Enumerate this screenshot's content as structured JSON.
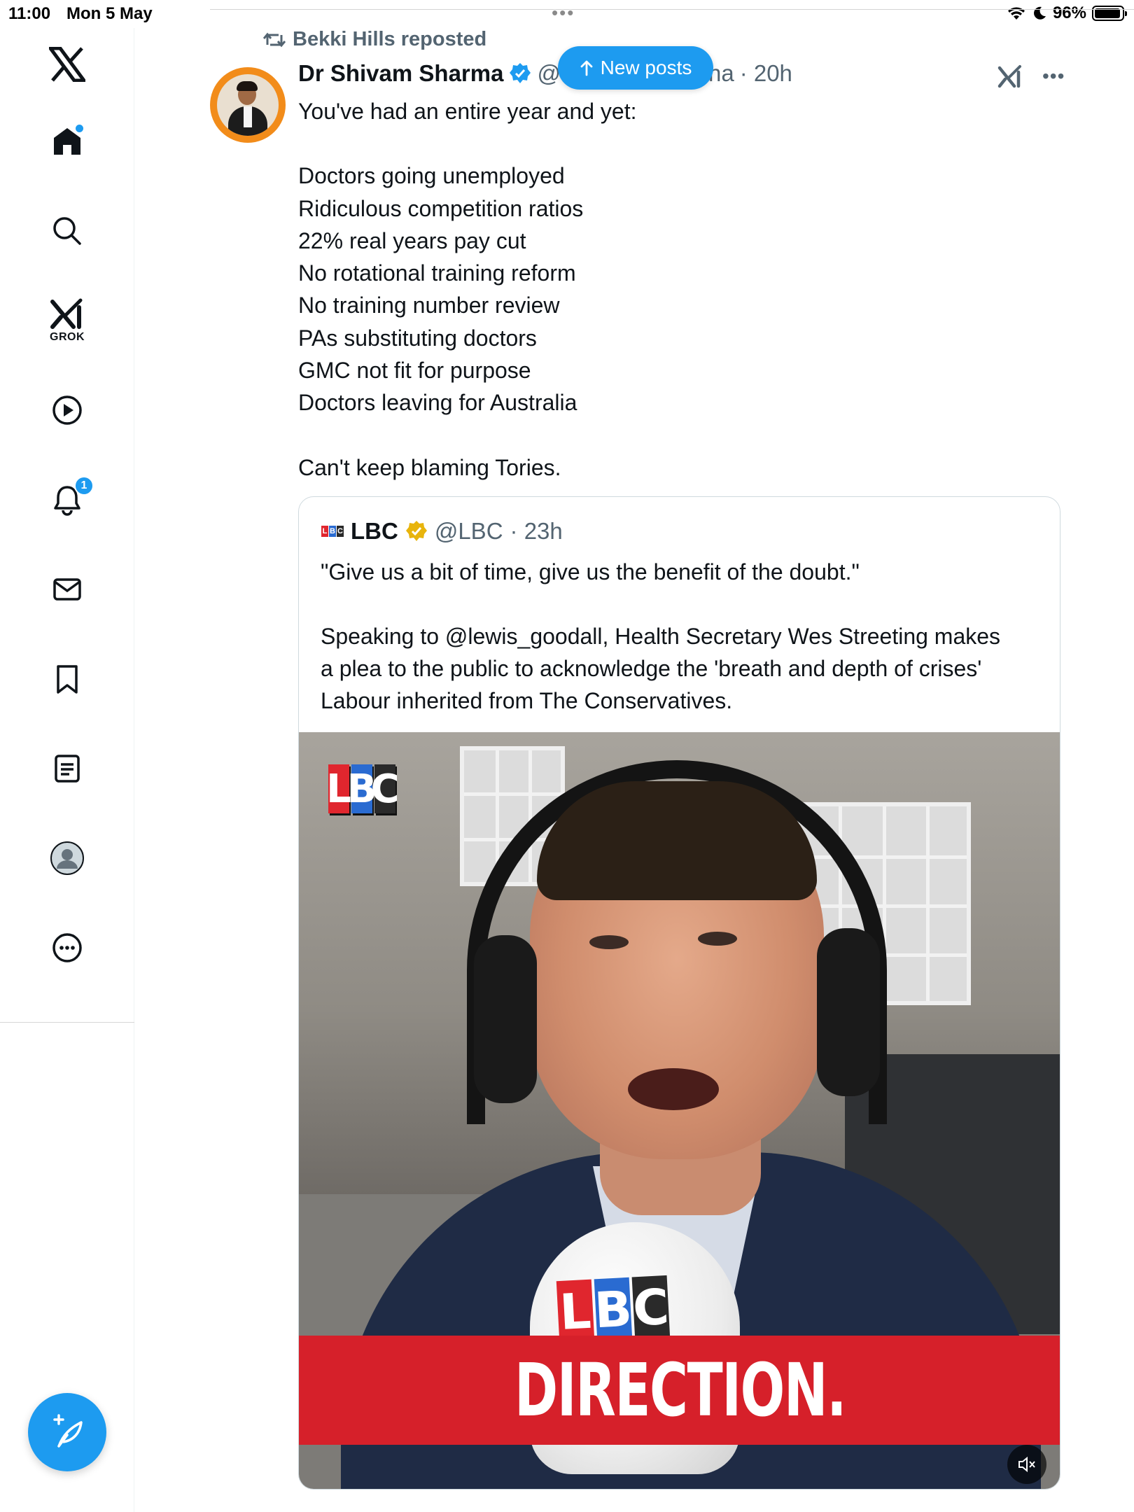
{
  "status_bar": {
    "time": "11:00",
    "date": "Mon 5 May",
    "battery_pct": "96%",
    "battery_level": 0.96,
    "icons": [
      "wifi-icon",
      "moon-icon",
      "battery-icon"
    ]
  },
  "sidebar": {
    "items": [
      {
        "name": "x-logo",
        "icon": "x-logo-icon"
      },
      {
        "name": "home",
        "icon": "home-icon"
      },
      {
        "name": "explore",
        "icon": "search-icon"
      },
      {
        "name": "grok",
        "icon": "grok-icon",
        "label": "GROK"
      },
      {
        "name": "videos",
        "icon": "play-icon"
      },
      {
        "name": "notifications",
        "icon": "bell-icon",
        "badge": "1"
      },
      {
        "name": "messages",
        "icon": "mail-icon"
      },
      {
        "name": "bookmarks",
        "icon": "bookmark-icon"
      },
      {
        "name": "lists",
        "icon": "list-icon"
      },
      {
        "name": "profile",
        "icon": "profile-icon"
      },
      {
        "name": "more",
        "icon": "more-icon"
      }
    ],
    "compose_icon": "compose-icon"
  },
  "new_posts": {
    "label": "New posts",
    "icon": "arrow-up-icon"
  },
  "tweet": {
    "repost_by": "Bekki Hills reposted",
    "author_name": "Dr Shivam Sharma",
    "handle_start": "@",
    "handle_end": "ha",
    "time": "· 20h",
    "lines": [
      "You've had an entire year and yet:",
      "",
      "Doctors going unemployed",
      "Ridiculous competition ratios",
      "22% real years pay cut",
      "No rotational training reform",
      "No training number review",
      "PAs substituting doctors",
      "GMC not fit for purpose",
      "Doctors leaving for Australia",
      "",
      "Can't keep blaming Tories."
    ]
  },
  "quote": {
    "logo_letters": [
      "L",
      "B",
      "C"
    ],
    "name": "LBC",
    "handle": "@LBC",
    "time": "· 23h",
    "lines": [
      "\"Give us a bit of time, give us the benefit of the doubt.\"",
      "",
      "Speaking to @lewis_goodall, Health Secretary Wes Streeting makes",
      "a plea to the public to acknowledge the 'breath and depth of crises'",
      "Labour inherited from The Conservatives."
    ],
    "video": {
      "corner_logo": [
        "L",
        "B",
        "C"
      ],
      "mic_logo": [
        "L",
        "B",
        "C"
      ],
      "caption": "DIRECTION.",
      "mute_icon": "mute-icon"
    }
  },
  "colors": {
    "accent": "#1d9bf0",
    "text_primary": "#0f1419",
    "text_secondary": "#536471",
    "verified_gold": "#e8b40c",
    "lbc_red": "#e0262e",
    "lbc_blue": "#2a6bd1",
    "lbc_dark": "#2a2a2a",
    "caption_red": "#d6202a"
  }
}
